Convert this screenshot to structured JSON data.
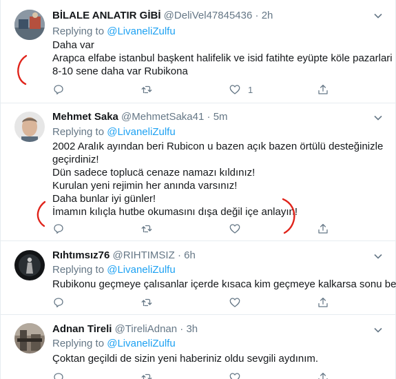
{
  "tweets": [
    {
      "name": "BİLALE ANLATIR GİBİ",
      "handle": "@DeliVel47845436",
      "dot": "·",
      "time": "2h",
      "replying_prefix": "Replying to ",
      "replying_to": "@LivaneliZulfu",
      "lines": [
        "Daha var",
        "Arapca elfabe istanbul başkent halifelik ve isid fatihte eyüpte köle pazarlari",
        "8-10 sene daha var Rubikona"
      ],
      "like_count": "1"
    },
    {
      "name": "Mehmet Saka",
      "handle": "@MehmetSaka41",
      "dot": "·",
      "time": "5m",
      "replying_prefix": "Replying to ",
      "replying_to": "@LivaneliZulfu",
      "lines": [
        "2002 Aralık ayından beri Rubicon u bazen açık bazen örtülü desteğinizle",
        "geçirdiniz!",
        "Dün sadece toplucä cenaze namazı kıldınız!",
        "Kurulan yeni rejimin her anında varsınız!",
        "Daha bunlar iyi günler!",
        "İmamın kılıçla hutbe okumasını dışa değil içe anlayın!"
      ],
      "like_count": ""
    },
    {
      "name": "Rıhtımsız76",
      "handle": "@RIHTIMSIZ",
      "dot": "·",
      "time": "6h",
      "replying_prefix": "Replying to ",
      "replying_to": "@LivaneliZulfu",
      "lines": [
        "Rubikonu geçmeye çalısanlar içerde kısaca kim geçmeye kalkarsa sonu belli"
      ],
      "like_count": ""
    },
    {
      "name": "Adnan Tireli",
      "handle": "@TireliAdnan",
      "dot": "·",
      "time": "3h",
      "replying_prefix": "Replying to ",
      "replying_to": "@LivaneliZulfu",
      "lines": [
        "Çoktan geçildi de sizin yeni haberiniz oldu sevgili aydınım."
      ],
      "like_count": ""
    }
  ],
  "icons": {
    "reply": "reply-icon",
    "retweet": "retweet-icon",
    "like": "heart-icon",
    "share": "share-icon",
    "menu": "chevron-down-icon"
  },
  "colors": {
    "text": "#14171a",
    "muted": "#657786",
    "link": "#1da1f2",
    "border": "#e6ecf0",
    "annotation": "#e0241b"
  }
}
